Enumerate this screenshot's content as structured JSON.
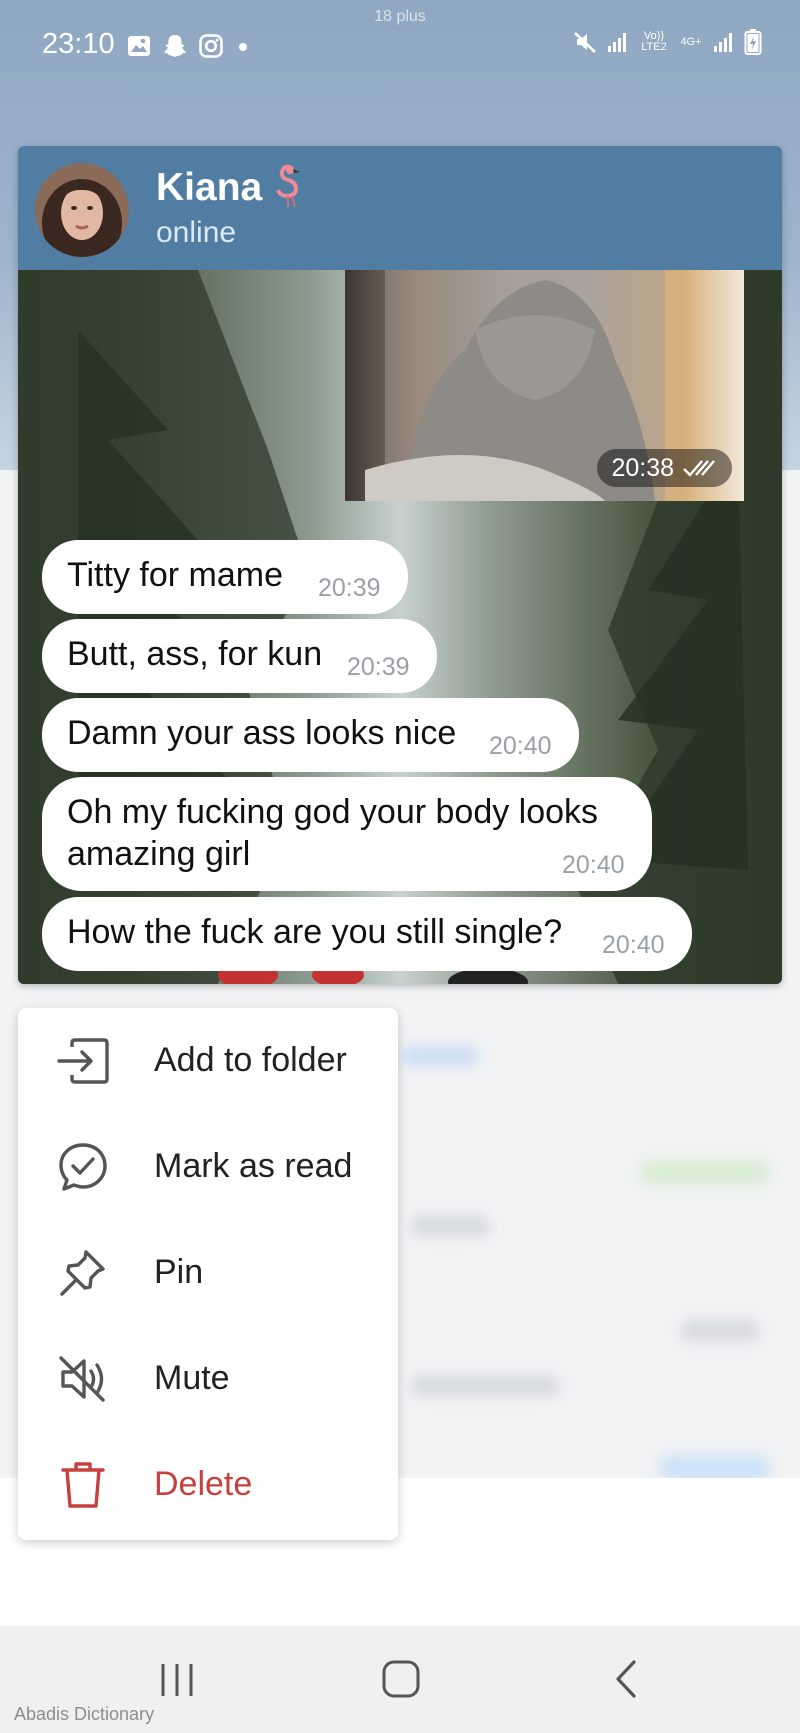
{
  "status_bar": {
    "top_note": "18 plus",
    "time": "23:10",
    "network_label_1": "Vo)) LTE2",
    "network_label_2": "4G+"
  },
  "chat_preview": {
    "contact_name": "Kiana",
    "name_emoji": "flamingo",
    "status": "online",
    "photo_message": {
      "time": "20:38",
      "read_icon": "double-check-icon"
    },
    "messages": [
      {
        "text": "Titty for mame",
        "time": "20:39"
      },
      {
        "text": "Butt, ass, for kun",
        "time": "20:39"
      },
      {
        "text": "Damn your ass looks nice",
        "time": "20:40"
      },
      {
        "text_line1": "Oh my fucking god your body looks",
        "text_line2": "amazing girl",
        "time": "20:40"
      },
      {
        "text": "How the fuck are you still single?",
        "time": "20:40"
      }
    ]
  },
  "context_menu": {
    "items": [
      {
        "label": "Add to folder",
        "icon": "folder-move-icon"
      },
      {
        "label": "Mark as read",
        "icon": "chat-check-icon"
      },
      {
        "label": "Pin",
        "icon": "pin-icon"
      },
      {
        "label": "Mute",
        "icon": "mute-icon"
      },
      {
        "label": "Delete",
        "icon": "trash-icon",
        "color": "#c6403e"
      }
    ]
  },
  "colors": {
    "header": "#517da2",
    "danger": "#c6403e"
  },
  "nav_bar": {
    "buttons": [
      "recent-apps-icon",
      "home-icon",
      "back-icon"
    ]
  },
  "footer_note": "Abadis Dictionary"
}
